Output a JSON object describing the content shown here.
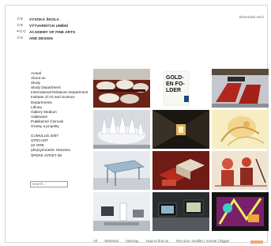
{
  "site": {
    "logo_marks": [
      "⊃ ∨",
      "⊃ ∨",
      "+ ⊂ ⊂",
      "⊃ ∨"
    ],
    "logo_lines": [
      "VYSOKÁ ŠKOLA",
      "VÝTVARNÝCH UMĚNÍ",
      "ACADEMY OF FINE ARTS",
      "AND DESIGN"
    ],
    "top_right_link": "Slovenská verzi"
  },
  "nav": {
    "group1": [
      "Actual",
      "About us",
      "Study",
      "Study Department",
      "International Relations Department",
      "Institute of Art and Science",
      "Departments",
      "Library",
      "Gallery Medium",
      "Adaleaton",
      "Publikačné Činnosti",
      "Granty a projekty"
    ],
    "group2": [
      "CUMULUS 2007",
      "STRCART",
      "art ORE",
      "(dis)symmetric Histories",
      "ŠPERK STRET 08"
    ]
  },
  "search": {
    "placeholder": "search..."
  },
  "tiles": [
    {
      "name": "photo-shoes-bags"
    },
    {
      "name": "poster-golden-folder",
      "text": "GOLD-\nEN FO-\nLDER"
    },
    {
      "name": "photo-red-installation"
    },
    {
      "name": "photo-spiked-sculpture"
    },
    {
      "name": "photo-dark-corridor"
    },
    {
      "name": "drawing-pastel-figure"
    },
    {
      "name": "photo-glass-table"
    },
    {
      "name": "photo-red-architecture-model"
    },
    {
      "name": "painting-figures-red"
    },
    {
      "name": "photo-gallery-room"
    },
    {
      "name": "photo-exhibition-screen"
    },
    {
      "name": "poster-neon-graphic"
    }
  ],
  "footer": [
    "All",
    "Webmail",
    "Sitemap",
    "How to find us",
    "Text size: smaller | normal | bigger"
  ],
  "colors": {
    "badge": "#f2a97a",
    "border": "#d6d6d6"
  }
}
